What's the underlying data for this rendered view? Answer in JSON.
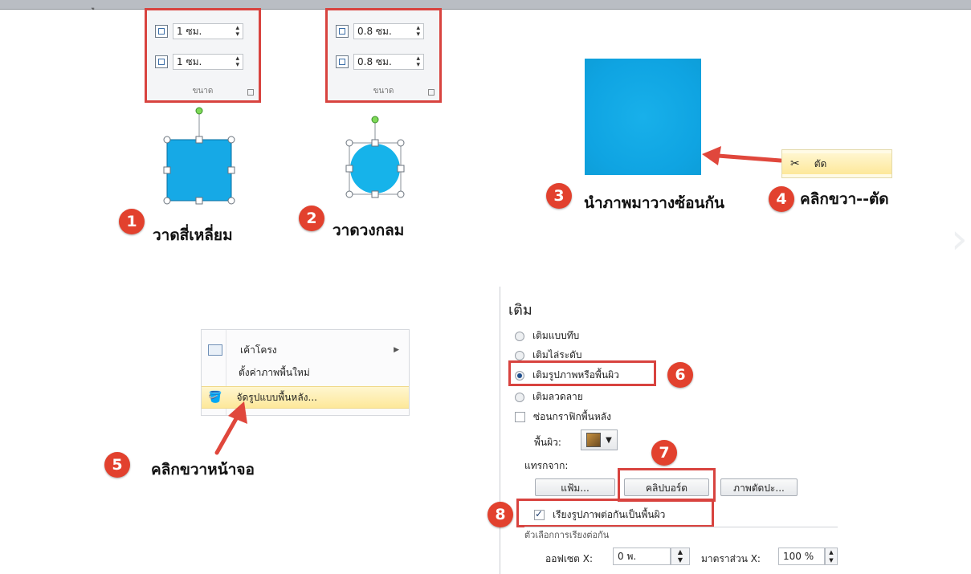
{
  "topbar": {
    "text": "ู"
  },
  "size_group_1": {
    "height_value": "1 ซม.",
    "width_value": "1 ซม.",
    "label": "ขนาด"
  },
  "size_group_2": {
    "height_value": "0.8 ซม.",
    "width_value": "0.8 ซม.",
    "label": "ขนาด"
  },
  "steps": {
    "s1": {
      "num": "1",
      "text": "วาดสี่เหลี่ยม"
    },
    "s2": {
      "num": "2",
      "text": "วาดวงกลม"
    },
    "s3": {
      "num": "3",
      "text": "นำภาพมาวางซ้อนกัน"
    },
    "s4": {
      "num": "4",
      "text": "คลิกขวา--ตัด"
    },
    "s5": {
      "num": "5",
      "text": "คลิกขวาหน้าจอ"
    },
    "s6": {
      "num": "6"
    },
    "s7": {
      "num": "7"
    },
    "s8": {
      "num": "8"
    }
  },
  "cut_menu": {
    "cut_label": "ตัด"
  },
  "context_menu": {
    "items": [
      "เค้าโครง",
      "ตั้งค่าภาพพื้นใหม่",
      "จัดรูปแบบพื้นหลัง..."
    ]
  },
  "fill_panel": {
    "title": "เติม",
    "options": [
      "เติมแบบทึบ",
      "เติมไล่ระดับ",
      "เติมรูปภาพหรือพื้นผิว",
      "เติมลวดลาย"
    ],
    "hide_bg_label": "ซ่อนกราฟิกพื้นหลัง",
    "texture_label": "พื้นผิว:",
    "insert_from_label": "แทรกจาก:",
    "buttons": [
      "แฟ้ม...",
      "คลิปบอร์ด",
      "ภาพตัดปะ..."
    ],
    "tile_label": "เรียงรูปภาพต่อกันเป็นพื้นผิว",
    "tiling_options_label": "ตัวเลือกการเรียงต่อกัน",
    "offset_x_label": "ออฟเซต X:",
    "offset_x_value": "0 พ.",
    "scale_x_label": "มาตราส่วน X:",
    "scale_x_value": "100 %"
  },
  "colors": {
    "accent_red": "#d8433f",
    "shape_blue": "#16a9e6",
    "badge_red": "#e2412e"
  }
}
